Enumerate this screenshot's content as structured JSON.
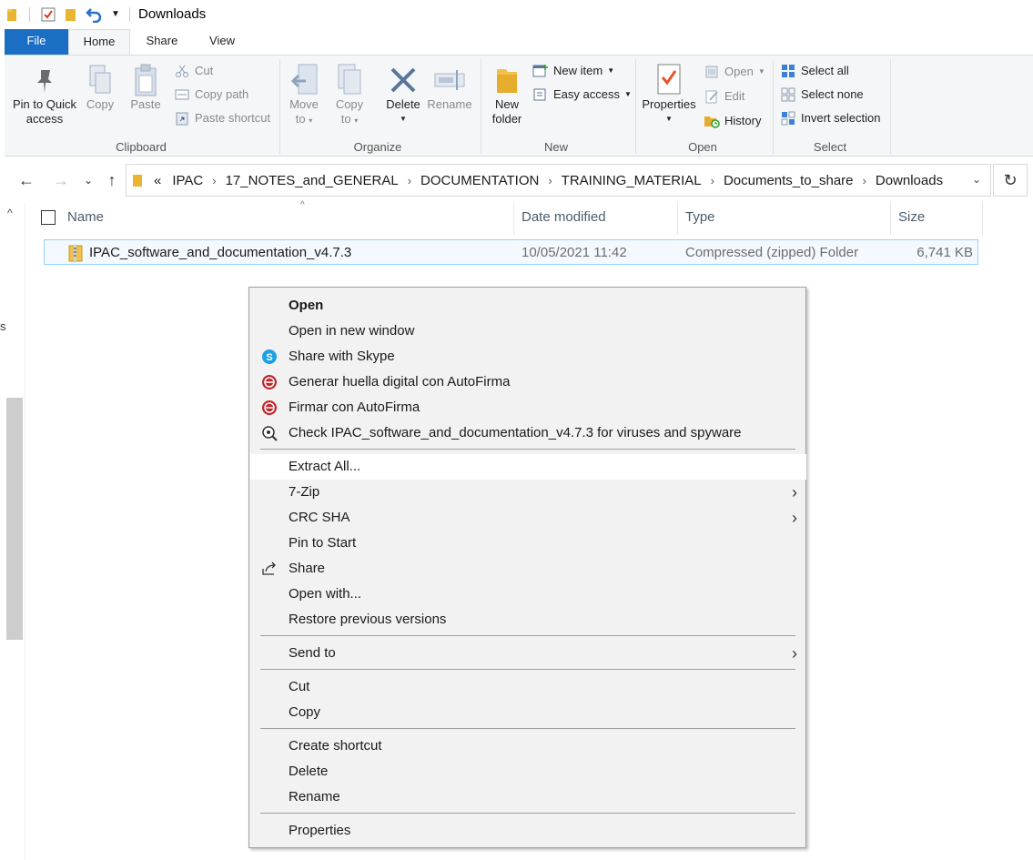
{
  "window": {
    "title": "Downloads"
  },
  "quick_access": {
    "icons": [
      "folder-icon",
      "properties-check-icon",
      "new-folder-icon",
      "undo-icon",
      "customize-dropdown-icon"
    ]
  },
  "ribbon_tabs": [
    "File",
    "Home",
    "Share",
    "View"
  ],
  "ribbon": {
    "clipboard": {
      "label": "Clipboard",
      "pin": "Pin to Quick access",
      "pin_line1": "Pin to Quick",
      "pin_line2": "access",
      "copy": "Copy",
      "paste": "Paste",
      "cut": "Cut",
      "copy_path": "Copy path",
      "paste_shortcut": "Paste shortcut"
    },
    "organize": {
      "label": "Organize",
      "move_to_l1": "Move",
      "move_to_l2": "to",
      "copy_to_l1": "Copy",
      "copy_to_l2": "to",
      "delete": "Delete",
      "rename": "Rename"
    },
    "new": {
      "label": "New",
      "new_folder_l1": "New",
      "new_folder_l2": "folder",
      "new_item": "New item",
      "easy_access": "Easy access"
    },
    "open": {
      "label": "Open",
      "properties": "Properties",
      "open": "Open",
      "edit": "Edit",
      "history": "History"
    },
    "select": {
      "label": "Select",
      "select_all": "Select all",
      "select_none": "Select none",
      "invert_selection": "Invert selection"
    }
  },
  "address": {
    "overflow": "«",
    "crumbs": [
      "IPAC",
      "17_NOTES_and_GENERAL",
      "DOCUMENTATION",
      "TRAINING_MATERIAL",
      "Documents_to_share",
      "Downloads"
    ]
  },
  "left_pane": {
    "stray_text": "s"
  },
  "columns": {
    "name": "Name",
    "date": "Date modified",
    "type": "Type",
    "size": "Size"
  },
  "files": [
    {
      "name": "IPAC_software_and_documentation_v4.7.3",
      "date": "10/05/2021 11:42",
      "type": "Compressed (zipped) Folder",
      "size": "6,741 KB"
    }
  ],
  "context_menu": {
    "items": [
      {
        "label": "Open",
        "bold": true
      },
      {
        "label": "Open in new window"
      },
      {
        "label": "Share with Skype",
        "icon": "skype-icon"
      },
      {
        "label": "Generar huella digital con AutoFirma",
        "icon": "autofirma-icon"
      },
      {
        "label": "Firmar con AutoFirma",
        "icon": "autofirma-icon"
      },
      {
        "label": "Check IPAC_software_and_documentation_v4.7.3 for viruses and spyware",
        "icon": "virus-scan-icon"
      },
      {
        "label": "Extract All...",
        "hover": true
      },
      {
        "label": "7-Zip",
        "submenu": true
      },
      {
        "label": "CRC SHA",
        "submenu": true
      },
      {
        "label": "Pin to Start"
      },
      {
        "label": "Share",
        "icon": "share-icon"
      },
      {
        "label": "Open with..."
      },
      {
        "label": "Restore previous versions"
      },
      {
        "label": "Send to",
        "submenu": true
      },
      {
        "label": "Cut"
      },
      {
        "label": "Copy"
      },
      {
        "label": "Create shortcut"
      },
      {
        "label": "Delete"
      },
      {
        "label": "Rename"
      },
      {
        "label": "Properties"
      }
    ]
  },
  "colors": {
    "file_tab": "#1a6fc4",
    "ribbon_bg": "#f5f6f7",
    "selection_border": "#99d1ff",
    "menu_bg": "#f2f2f2",
    "autofirma_red": "#c0272d",
    "skype_blue": "#1da1e2"
  }
}
